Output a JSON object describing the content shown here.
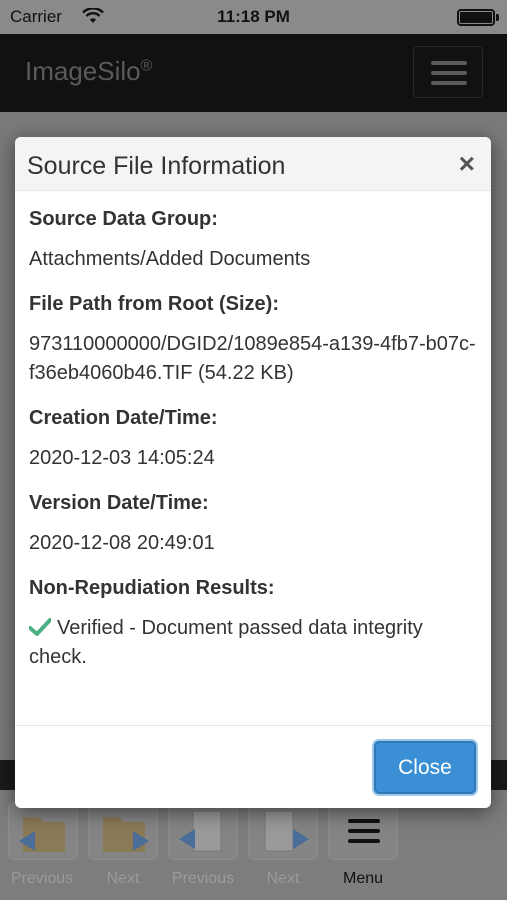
{
  "status_bar": {
    "carrier": "Carrier",
    "time": "11:18 PM"
  },
  "navbar": {
    "brand": "ImageSilo",
    "brand_mark": "®"
  },
  "toolbar": {
    "items": [
      {
        "label": "Previous",
        "icon": "folder-previous-icon"
      },
      {
        "label": "Next",
        "icon": "folder-next-icon"
      },
      {
        "label": "Previous",
        "icon": "document-previous-icon"
      },
      {
        "label": "Next",
        "icon": "document-next-icon"
      },
      {
        "label": "Menu",
        "icon": "menu-icon"
      }
    ]
  },
  "modal": {
    "title": "Source File Information",
    "close_symbol": "×",
    "fields": {
      "source_data_group": {
        "label": "Source Data Group:",
        "value": "Attachments/Added Documents"
      },
      "file_path": {
        "label": "File Path from Root (Size):",
        "value": "973110000000/DGID2/1089e854-a139-4fb7-b07c-f36eb4060b46.TIF (54.22 KB)"
      },
      "creation": {
        "label": "Creation Date/Time:",
        "value": "2020-12-03 14:05:24"
      },
      "version": {
        "label": "Version Date/Time:",
        "value": "2020-12-08 20:49:01"
      },
      "non_repudiation": {
        "label": "Non-Repudiation Results:",
        "value": "Verified - Document passed data integrity check."
      }
    },
    "close_button": "Close"
  },
  "colors": {
    "accent": "#3b8fd5",
    "check": "#4caf84"
  }
}
